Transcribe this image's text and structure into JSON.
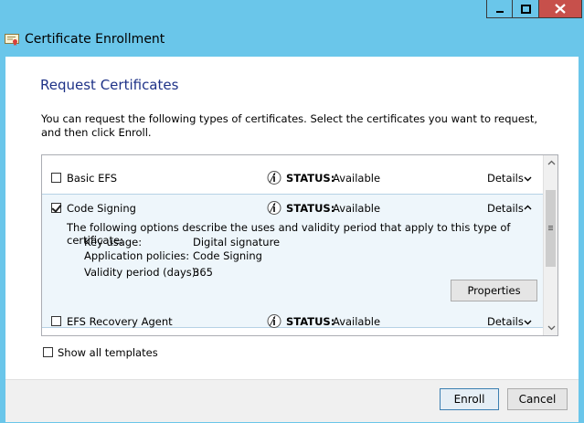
{
  "window": {
    "title": "Certificate Enrollment"
  },
  "dialog": {
    "heading": "Request Certificates",
    "description": "You can request the following types of certificates. Select the certificates you want to request, and then click Enroll."
  },
  "certificates": [
    {
      "name": "Basic EFS",
      "checked": false,
      "status_label": "STATUS:",
      "status_value": "Available",
      "details_label": "Details",
      "expanded": false
    },
    {
      "name": "Code Signing",
      "checked": true,
      "status_label": "STATUS:",
      "status_value": "Available",
      "details_label": "Details",
      "expanded": true,
      "expanded_info": {
        "intro": "The following options describe the uses and validity period that apply to this type of certificate:",
        "key_usage_label": "Key usage:",
        "key_usage_value": "Digital signature",
        "app_policies_label": "Application policies:",
        "app_policies_value": "Code Signing",
        "validity_label": "Validity period (days):",
        "validity_value": "365",
        "properties_button": "Properties"
      }
    },
    {
      "name": "EFS Recovery Agent",
      "checked": false,
      "status_label": "STATUS:",
      "status_value": "Available",
      "details_label": "Details",
      "expanded": false
    }
  ],
  "options": {
    "show_all_templates_label": "Show all templates",
    "show_all_templates_checked": false
  },
  "buttons": {
    "enroll": "Enroll",
    "cancel": "Cancel"
  },
  "colors": {
    "title_bar": "#6ac6ea",
    "close_button": "#c7504b",
    "heading": "#1e3287",
    "selected_row": "#eef6fb"
  }
}
